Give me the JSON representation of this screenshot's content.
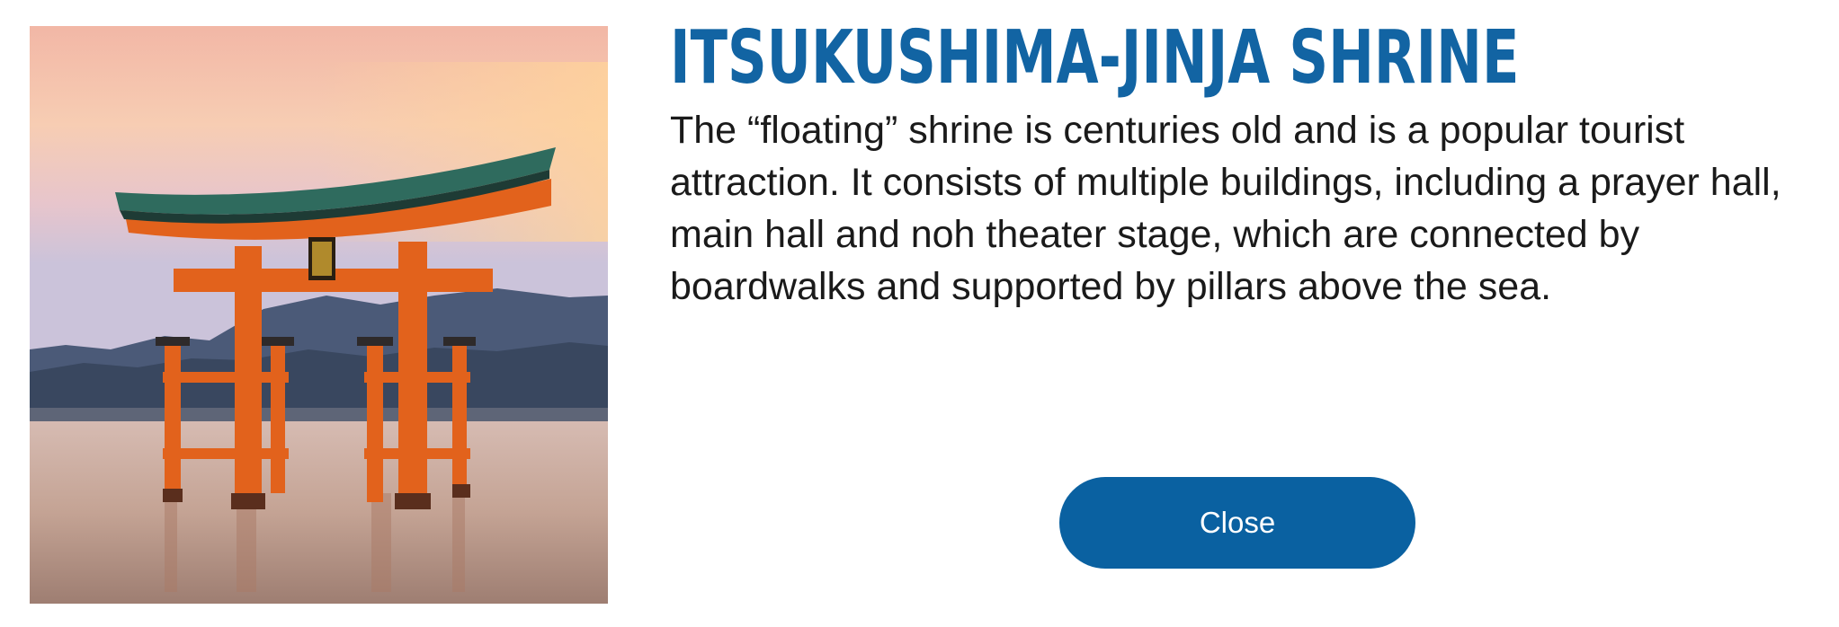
{
  "modal": {
    "title": "ITSUKUSHIMA-JINJA SHRINE",
    "description": "The “floating” shrine is centuries old and is a popular tourist attraction. It consists of multiple buildings, including a prayer hall, main hall and noh theater stage, which are connected by boardwalks and supported by pillars above the sea.",
    "close_label": "Close"
  },
  "image": {
    "subject": "itsukushima-torii-gate",
    "colors": {
      "sky_top": "#f4bfae",
      "mountain": "#3e4d68",
      "water": "#c7a99c",
      "gate": "#e2621c",
      "roof": "#2f6b5e"
    }
  },
  "colors": {
    "title": "#1264a3",
    "button": "#0a61a1",
    "button_text": "#ffffff",
    "body_text": "#1a1a1a"
  }
}
